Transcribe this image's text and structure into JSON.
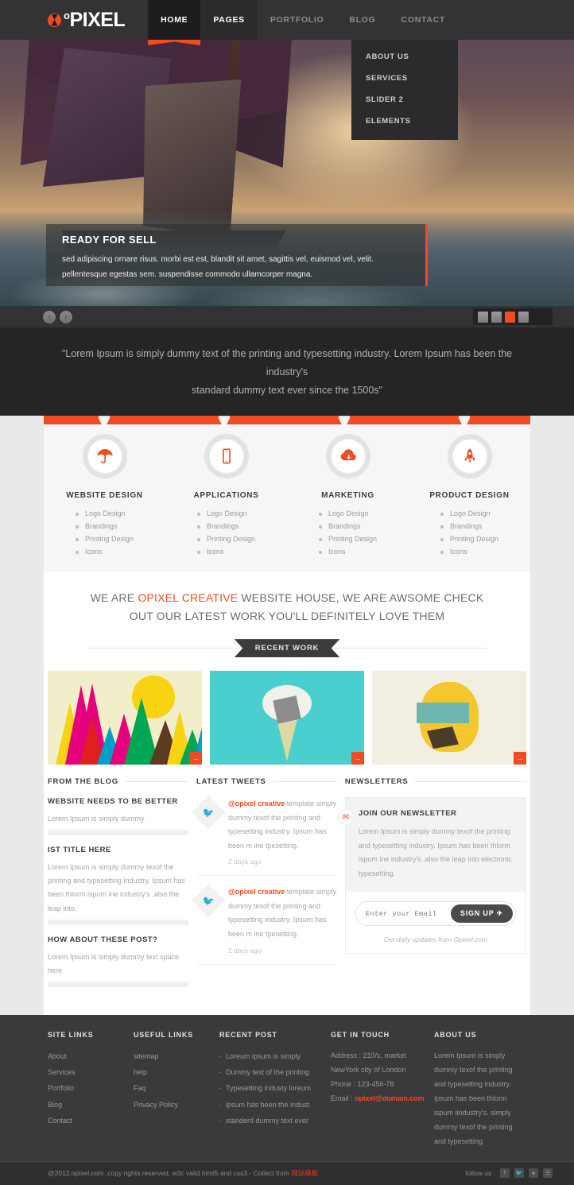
{
  "brand": {
    "name": "PIXEL",
    "degree": "o",
    "accent": "#f04b23"
  },
  "nav": {
    "items": [
      {
        "label": "HOME",
        "state": "active"
      },
      {
        "label": "PAGES",
        "state": "open"
      },
      {
        "label": "PORTFOLIO",
        "state": ""
      },
      {
        "label": "BLOG",
        "state": ""
      },
      {
        "label": "CONTACT",
        "state": ""
      }
    ],
    "dropdown": [
      {
        "label": "ABOUT US"
      },
      {
        "label": "SERVICES"
      },
      {
        "label": "SLIDER 2"
      },
      {
        "label": "ELEMENTS"
      }
    ]
  },
  "slider": {
    "caption_title": "READY FOR SELL",
    "caption_text": "sed adipiscing ornare risus. morbi est est, blandit sit amet, sagittis vel, euismod vel, velit. pellentesque egestas sem. suspendisse commodo ullamcorper magna.",
    "prev_icon": "‹",
    "next_icon": "›",
    "dots": [
      {
        "active": false
      },
      {
        "active": false
      },
      {
        "active": true
      },
      {
        "active": false
      }
    ]
  },
  "quote": {
    "line1": "\"Lorem Ipsum is simply dummy text of the printing and typesetting industry. Lorem Ipsum has been the industry's",
    "line2": "standard dummy text ever since the 1500s\""
  },
  "services": [
    {
      "icon": "umbrella-icon",
      "title": "WEBSITE DESIGN",
      "items": [
        "Logo Design",
        "Brandings",
        "Printing Design",
        "Icons"
      ]
    },
    {
      "icon": "mobile-icon",
      "title": "APPLICATIONS",
      "items": [
        "Logo Design",
        "Brandings",
        "Printing Design",
        "Icons"
      ]
    },
    {
      "icon": "cloud-download-icon",
      "title": "MARKETING",
      "items": [
        "Logo Design",
        "Brandings",
        "Printing Design",
        "Icons"
      ]
    },
    {
      "icon": "rocket-icon",
      "title": "PRODUCT DESIGN",
      "items": [
        "Logo Design",
        "Brandings",
        "Printing Design",
        "Icons"
      ]
    }
  ],
  "tagline": {
    "pre": "WE ARE ",
    "highlight": "OPIXEL CREATIVE",
    "post": " WEBSITE HOUSE, WE ARE AWSOME CHECK OUT OUR LATEST WORK YOU'LL DEFINITELY LOVE THEM",
    "ribbon": "RECENT WORK"
  },
  "work": {
    "more_icon": "→",
    "items": [
      {
        "alt": "colorful-mountains-artwork"
      },
      {
        "alt": "ice-cream-cone-artwork"
      },
      {
        "alt": "abstract-face-artwork"
      }
    ]
  },
  "blog": {
    "heading": "FROM THE BLOG",
    "posts": [
      {
        "title": "WEBSITE NEEDS TO BE BETTER",
        "text": "Lorem Ipsum is simply dummy"
      },
      {
        "title": "IST TITLE HERE",
        "text": "Lorem Ipsum is simply dummy texof the printing and typesetting industry. Ipsum has been thlorm ispum ine industry's .also the leap into."
      },
      {
        "title": "HOW ABOUT THESE POST?",
        "text": "Lorem Ipsum is simply dummy text space here"
      }
    ]
  },
  "tweets": {
    "heading": "LATEST TWEETS",
    "items": [
      {
        "icon": "bird-icon",
        "handle": "@opixel creative",
        "text": " template simply dummy texof the printing and typesetting industry. Ipsum has been m ine tpesetting.",
        "ago": "2 days ago"
      },
      {
        "icon": "bird-icon",
        "handle": "@opixel creative",
        "text": " template simply dummy texof the printing and typesetting industry. Ipsum has been m ine tpesetting.",
        "ago": "2 days ago"
      }
    ]
  },
  "newsletter": {
    "heading": "NEWSLETTERS",
    "badge_icon": "envelope-icon",
    "title": "JOIN OUR NEWSLETTER",
    "text": "Lorem Ipsum is simply dummy texof the printing and typesetting industry. Ipsum has been thlorm ispum ine industry's .also the leap into electronic typesetting.",
    "placeholder": "Enter your Email",
    "input_value": "",
    "button_label": "SIGN UP ✈",
    "note": "Get daily updates from Opixel.com"
  },
  "footer": {
    "site_links": {
      "title": "SITE LINKS",
      "items": [
        "About",
        "Services",
        "Portfolio",
        "Blog",
        "Contact"
      ]
    },
    "useful_links": {
      "title": "USEFUL LINKS",
      "items": [
        "sitemap",
        "help",
        "Faq",
        "Privacy Policy"
      ]
    },
    "recent_post": {
      "title": "RECENT POST",
      "items": [
        "Loreum ipsum is simply",
        "Dummy text of the printing",
        "Typesetting industy loreum",
        "ipsum has been the indust",
        "standerd dummy text ever"
      ]
    },
    "get_in_touch": {
      "title": "GET IN TOUCH",
      "address1": "Address : 210/c, market",
      "address2": "NewYork city of London",
      "phone": "Phone : 123-456-78",
      "email_label": "Email : ",
      "email": "opixel@domain.com"
    },
    "about": {
      "title": "ABOUT US",
      "text": "Lorem Ipsum is simply dummy texof the printing and typesetting industry. Ipsum has been thlorm ispum iindustry's. simply dummy texof the printing and typesetting"
    }
  },
  "copyright": {
    "text": "@2012,opixel.com ,copy rights reserved, w3c valid html5 and css3 - Collect from ",
    "link": "网站模板",
    "follow_label": "follow us :",
    "socials": [
      "facebook-icon",
      "twitter-icon",
      "dribbble-icon",
      "rss-icon"
    ]
  }
}
